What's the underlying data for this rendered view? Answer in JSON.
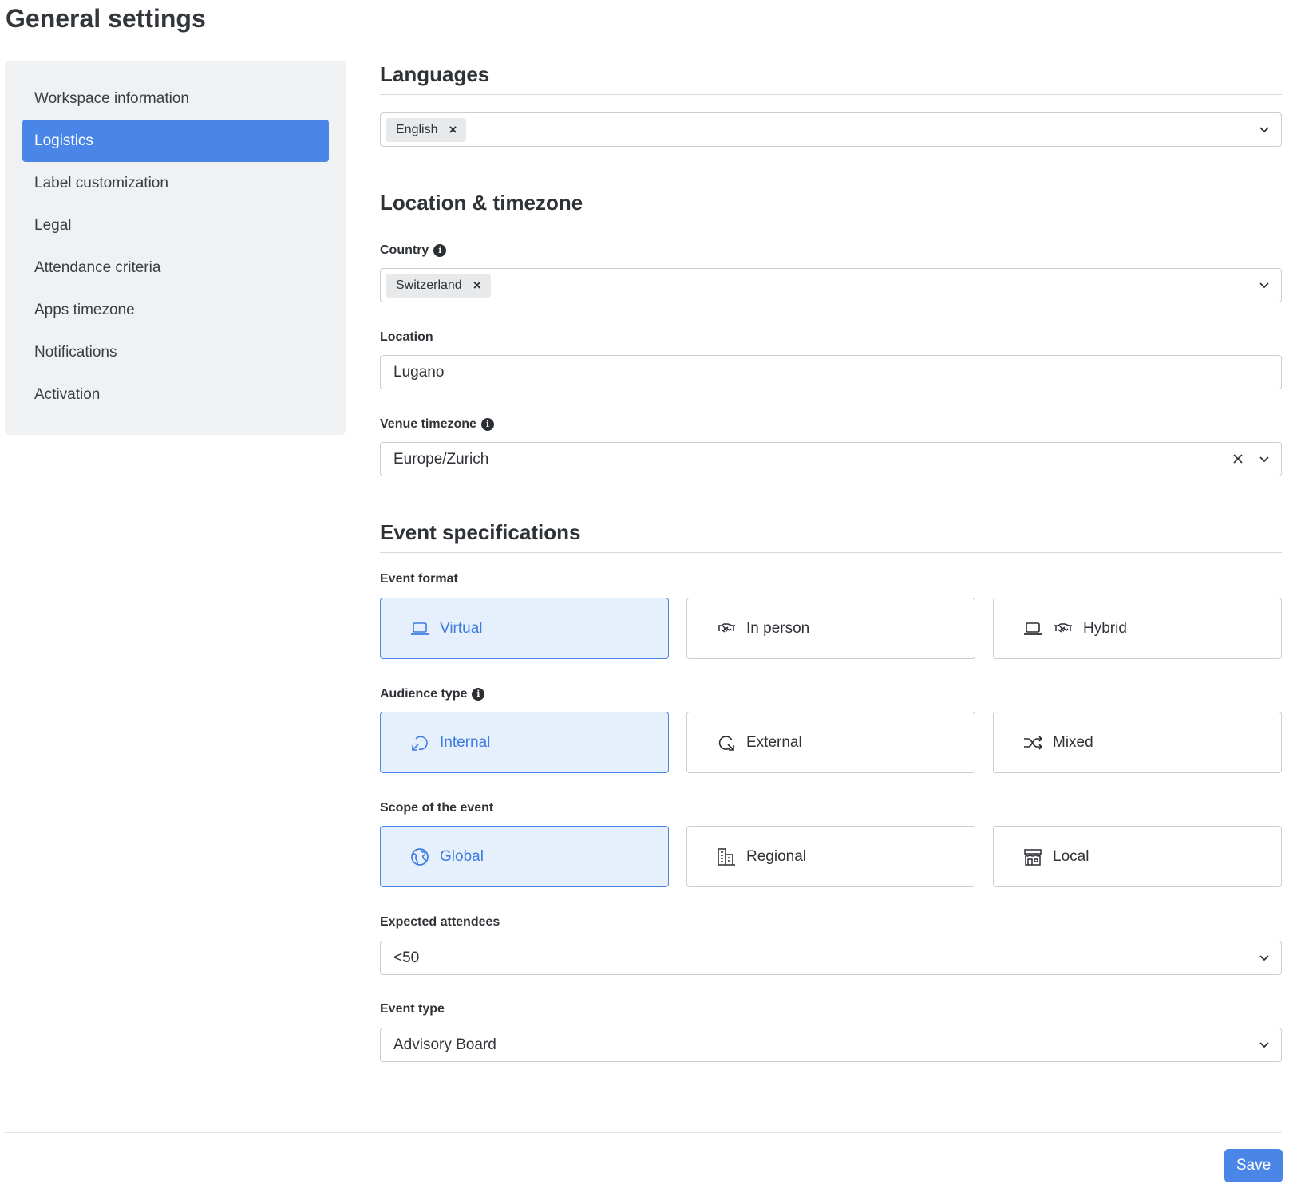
{
  "page": {
    "title": "General settings"
  },
  "sidebar": {
    "items": [
      {
        "label": "Workspace information"
      },
      {
        "label": "Logistics",
        "active": true
      },
      {
        "label": "Label customization"
      },
      {
        "label": "Legal"
      },
      {
        "label": "Attendance criteria"
      },
      {
        "label": "Apps timezone"
      },
      {
        "label": "Notifications"
      },
      {
        "label": "Activation"
      }
    ]
  },
  "languages": {
    "title": "Languages",
    "selected": [
      "English"
    ]
  },
  "location_timezone": {
    "title": "Location & timezone",
    "country": {
      "label": "Country",
      "selected": [
        "Switzerland"
      ]
    },
    "location": {
      "label": "Location",
      "value": "Lugano"
    },
    "venue_timezone": {
      "label": "Venue timezone",
      "value": "Europe/Zurich"
    }
  },
  "event_specs": {
    "title": "Event specifications",
    "event_format": {
      "label": "Event format",
      "options": [
        {
          "label": "Virtual",
          "icon": "laptop-icon",
          "selected": true
        },
        {
          "label": "In person",
          "icon": "handshake-icon",
          "selected": false
        },
        {
          "label": "Hybrid",
          "icon": "laptop-handshake-icon",
          "selected": false
        }
      ]
    },
    "audience_type": {
      "label": "Audience type",
      "options": [
        {
          "label": "Internal",
          "icon": "arrow-in-circle-icon",
          "selected": true
        },
        {
          "label": "External",
          "icon": "arrow-out-circle-icon",
          "selected": false
        },
        {
          "label": "Mixed",
          "icon": "shuffle-icon",
          "selected": false
        }
      ]
    },
    "scope": {
      "label": "Scope of the event",
      "options": [
        {
          "label": "Global",
          "icon": "globe-icon",
          "selected": true
        },
        {
          "label": "Regional",
          "icon": "buildings-icon",
          "selected": false
        },
        {
          "label": "Local",
          "icon": "storefront-icon",
          "selected": false
        }
      ]
    },
    "expected_attendees": {
      "label": "Expected attendees",
      "value": "<50"
    },
    "event_type": {
      "label": "Event type",
      "value": "Advisory Board"
    }
  },
  "footer": {
    "save_label": "Save"
  },
  "colors": {
    "accent": "#4a86e8",
    "selected_bg": "#e6effc",
    "sidebar_bg": "#f0f1f3"
  }
}
